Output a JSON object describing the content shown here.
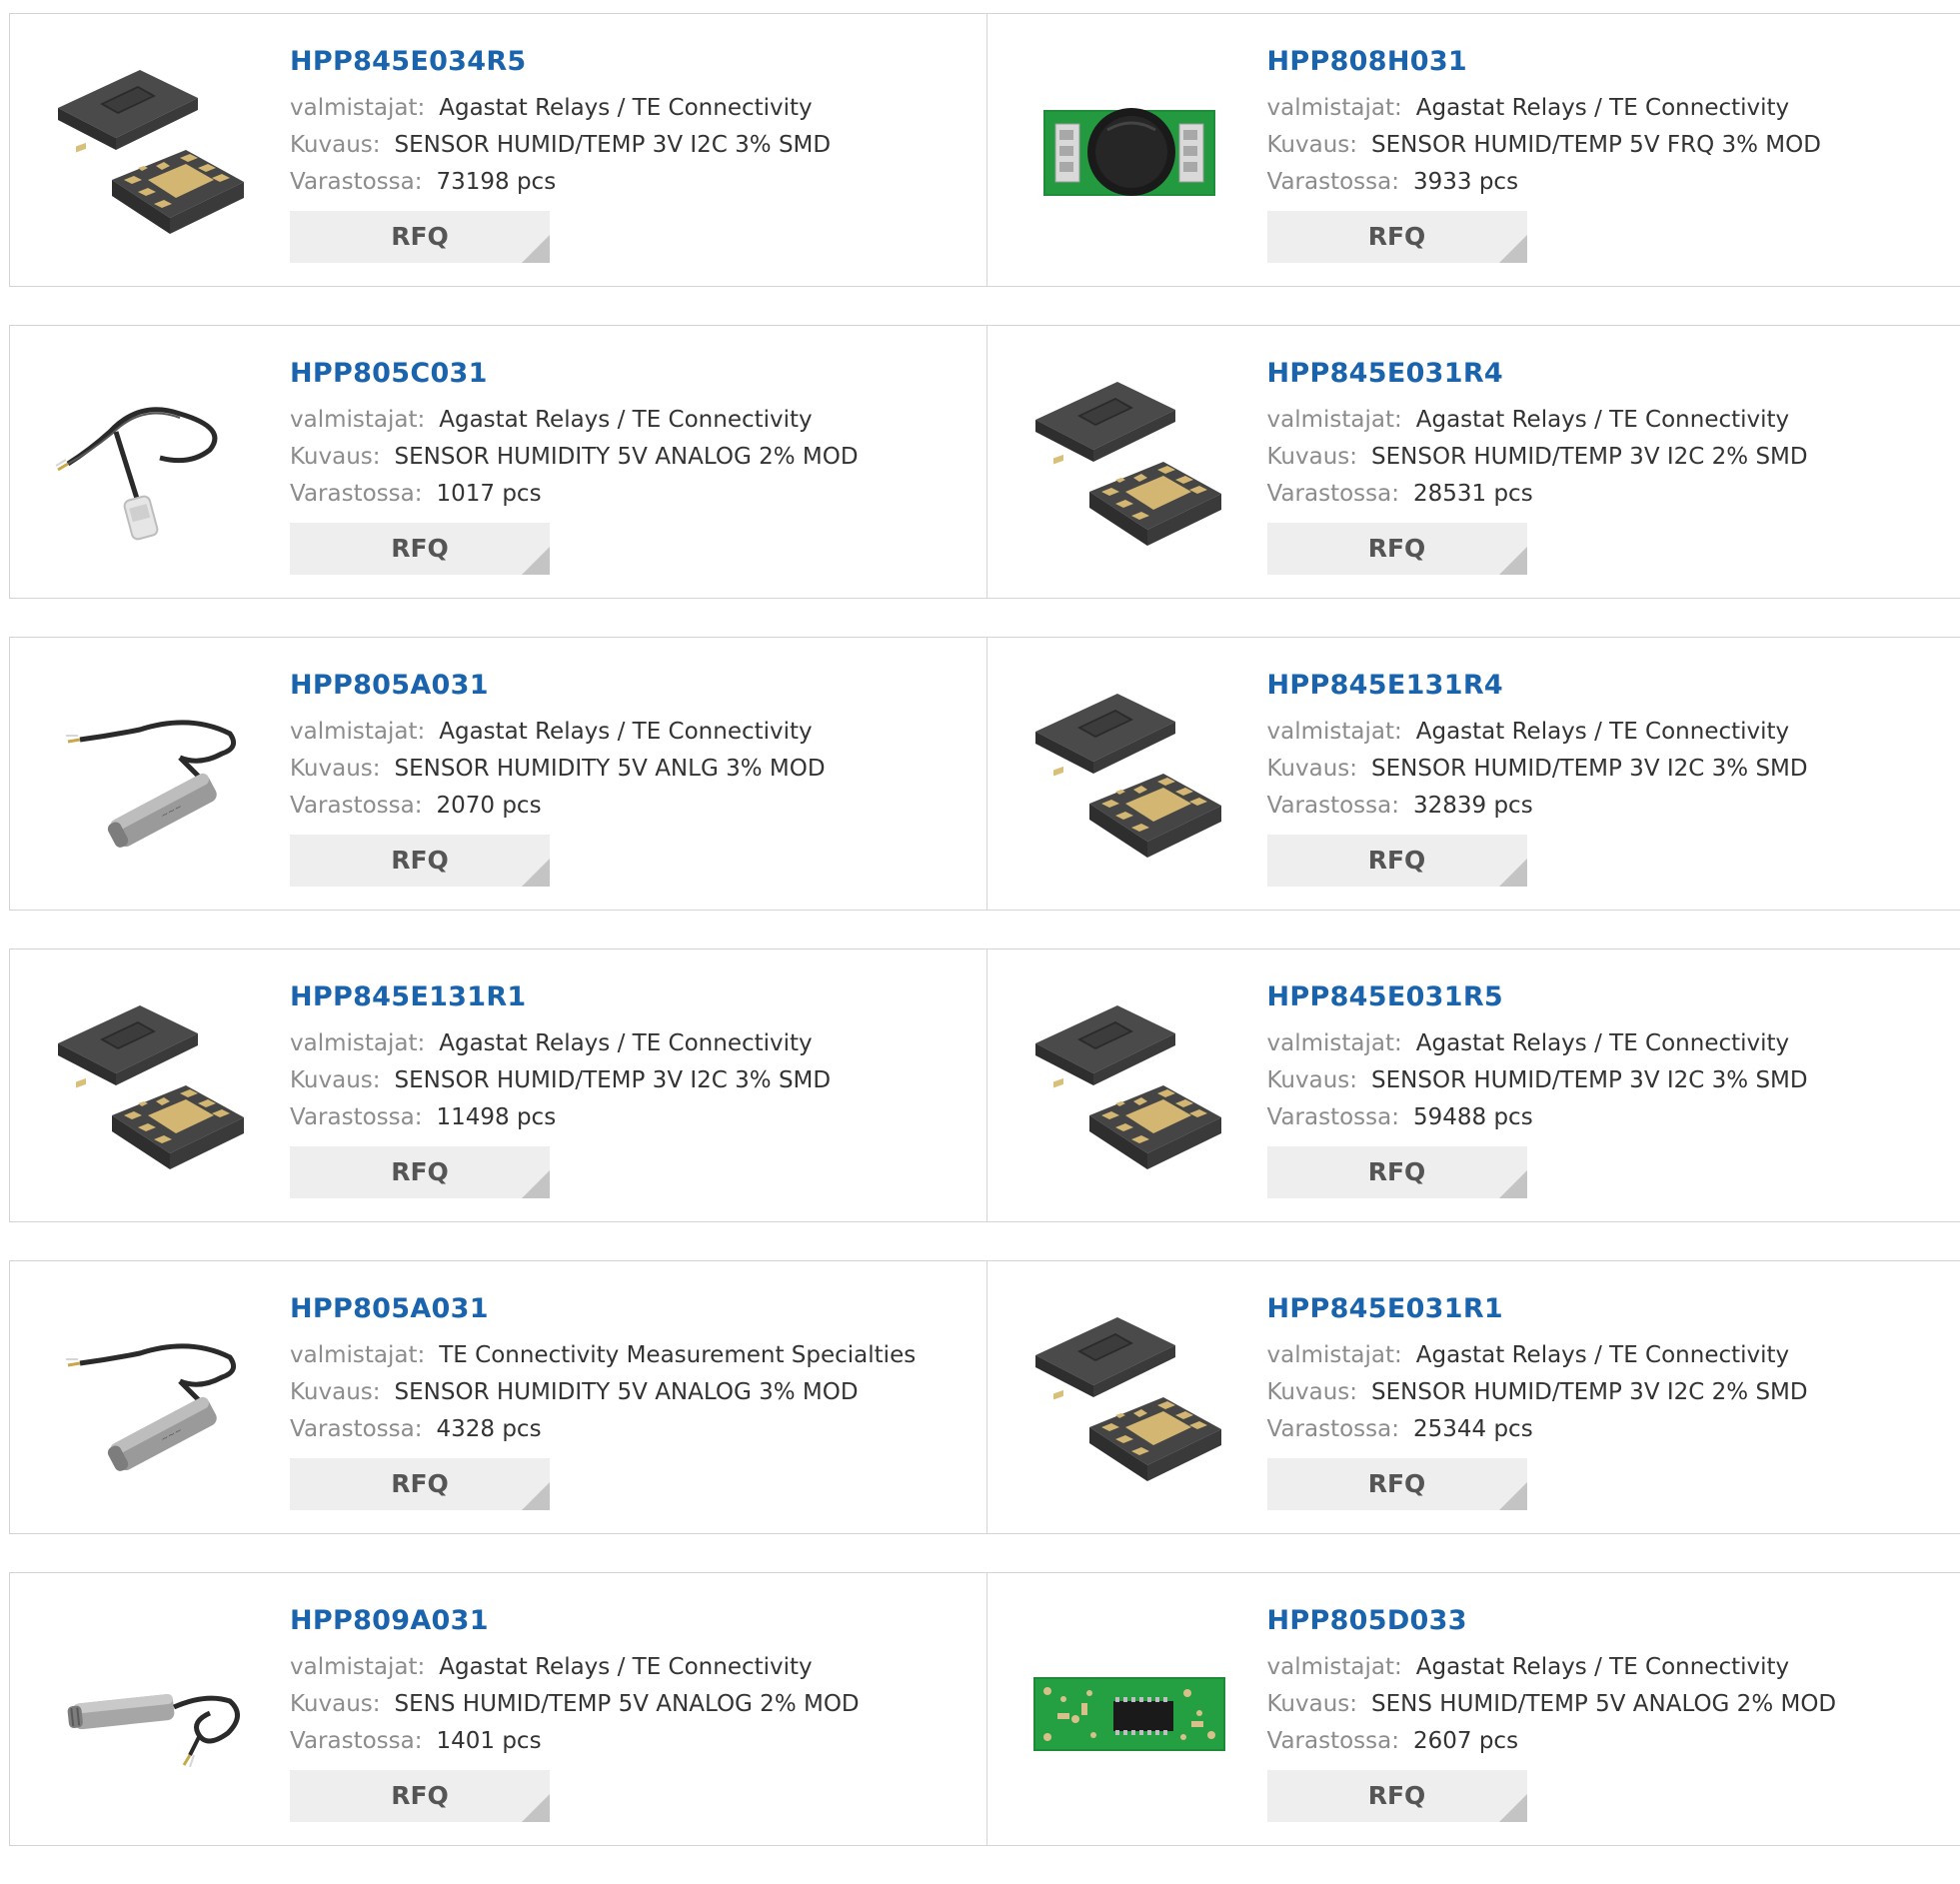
{
  "labels": {
    "manufacturer": "valmistajat:",
    "description": "Kuvaus:",
    "stock": "Varastossa:",
    "rfq": "RFQ"
  },
  "colors": {
    "title": "#1a63ad",
    "label": "#8c8c8c",
    "value": "#333333",
    "rfq_bg": "#eeeeee",
    "rfq_corner": "#c4c4c4",
    "border": "#d4d4d4"
  },
  "products": [
    {
      "part": "HPP845E034R5",
      "manufacturer": "Agastat Relays / TE Connectivity",
      "description": "SENSOR HUMID/TEMP 3V I2C 3% SMD",
      "stock": "73198 pcs",
      "image": "smd-sensor-package"
    },
    {
      "part": "HPP808H031",
      "manufacturer": "Agastat Relays / TE Connectivity",
      "description": "SENSOR HUMID/TEMP 5V FRQ 3% MOD",
      "stock": "3933 pcs",
      "image": "green-pcb-module"
    },
    {
      "part": "HPP805C031",
      "manufacturer": "Agastat Relays / TE Connectivity",
      "description": "SENSOR HUMIDITY 5V ANALOG 2% MOD",
      "stock": "1017 pcs",
      "image": "cable-probe-clear"
    },
    {
      "part": "HPP845E031R4",
      "manufacturer": "Agastat Relays / TE Connectivity",
      "description": "SENSOR HUMID/TEMP 3V I2C 2% SMD",
      "stock": "28531 pcs",
      "image": "smd-sensor-package"
    },
    {
      "part": "HPP805A031",
      "manufacturer": "Agastat Relays / TE Connectivity",
      "description": "SENSOR HUMIDITY 5V ANLG 3% MOD",
      "stock": "2070 pcs",
      "image": "cable-probe-metal"
    },
    {
      "part": "HPP845E131R4",
      "manufacturer": "Agastat Relays / TE Connectivity",
      "description": "SENSOR HUMID/TEMP 3V I2C 3% SMD",
      "stock": "32839 pcs",
      "image": "smd-sensor-package"
    },
    {
      "part": "HPP845E131R1",
      "manufacturer": "Agastat Relays / TE Connectivity",
      "description": "SENSOR HUMID/TEMP 3V I2C 3% SMD",
      "stock": "11498 pcs",
      "image": "smd-sensor-package"
    },
    {
      "part": "HPP845E031R5",
      "manufacturer": "Agastat Relays / TE Connectivity",
      "description": "SENSOR HUMID/TEMP 3V I2C 3% SMD",
      "stock": "59488 pcs",
      "image": "smd-sensor-package"
    },
    {
      "part": "HPP805A031",
      "manufacturer": "TE Connectivity Measurement Specialties",
      "description": "SENSOR HUMIDITY 5V ANALOG 3% MOD",
      "stock": "4328 pcs",
      "image": "cable-probe-metal"
    },
    {
      "part": "HPP845E031R1",
      "manufacturer": "Agastat Relays / TE Connectivity",
      "description": "SENSOR HUMID/TEMP 3V I2C 2% SMD",
      "stock": "25344 pcs",
      "image": "smd-sensor-package"
    },
    {
      "part": "HPP809A031",
      "manufacturer": "Agastat Relays / TE Connectivity",
      "description": "SENS HUMID/TEMP 5V ANALOG 2% MOD",
      "stock": "1401 pcs",
      "image": "cable-probe-horizontal"
    },
    {
      "part": "HPP805D033",
      "manufacturer": "Agastat Relays / TE Connectivity",
      "description": "SENS HUMID/TEMP 5V ANALOG 2% MOD",
      "stock": "2607 pcs",
      "image": "green-pcb-board"
    }
  ]
}
